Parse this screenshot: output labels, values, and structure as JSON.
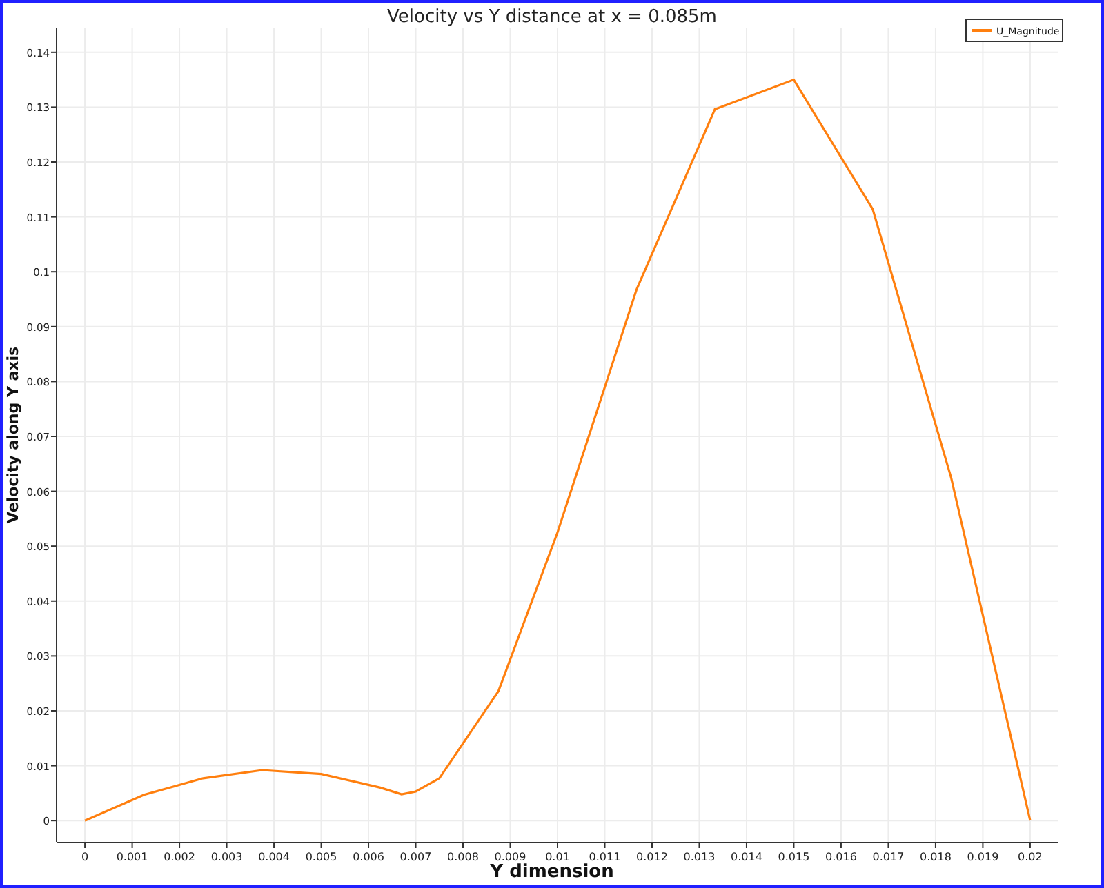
{
  "chart_data": {
    "type": "line",
    "grid": true,
    "title": "Velocity vs Y distance at x = 0.085m",
    "xlabel": "Y dimension",
    "ylabel": "Velocity along Y axis",
    "x": [
      0,
      0.00125,
      0.0025,
      0.00375,
      0.005,
      0.00625,
      0.0067,
      0.007,
      0.0075,
      0.00875,
      0.01,
      0.01167,
      0.01333,
      0.015,
      0.01667,
      0.01833,
      0.02
    ],
    "series": [
      {
        "name": "U_Magnitude",
        "color": "#ff7f0e",
        "values": [
          0,
          0.0047,
          0.0077,
          0.0092,
          0.0085,
          0.006,
          0.0048,
          0.0053,
          0.0077,
          0.0236,
          0.0525,
          0.0967,
          0.1296,
          0.135,
          0.1114,
          0.0624,
          0
        ]
      }
    ],
    "xlim": [
      -0.0006,
      0.0206
    ],
    "ylim": [
      -0.004,
      0.1445
    ],
    "xticks": [
      0,
      0.001,
      0.002,
      0.003,
      0.004,
      0.005,
      0.006,
      0.007,
      0.008,
      0.009,
      0.01,
      0.011,
      0.012,
      0.013,
      0.014,
      0.015,
      0.016,
      0.017,
      0.018,
      0.019,
      0.02
    ],
    "yticks": [
      0,
      0.01,
      0.02,
      0.03,
      0.04,
      0.05,
      0.06,
      0.07,
      0.08,
      0.09,
      0.1,
      0.11,
      0.12,
      0.13,
      0.14
    ]
  }
}
